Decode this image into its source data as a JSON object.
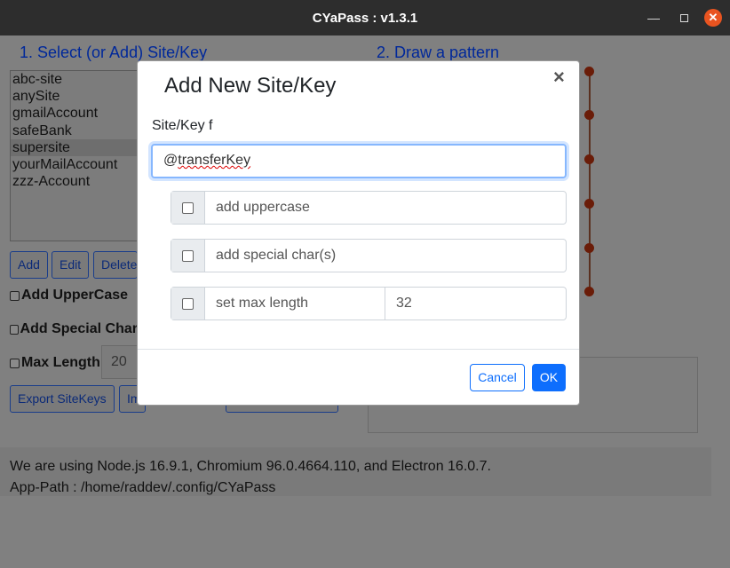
{
  "window": {
    "title": "CYaPass : v1.3.1"
  },
  "app": {
    "section1_heading": "1. Select (or Add) Site/Key",
    "section2_heading": "2. Draw a pattern",
    "site_list": [
      "abc-site",
      "anySite",
      "gmailAccount",
      "safeBank",
      "supersite",
      "yourMailAccount",
      "zzz-Account"
    ],
    "selected_site": "supersite",
    "buttons": {
      "add": "Add",
      "edit": "Edit",
      "delete": "Delete",
      "export": "Export SiteKeys",
      "import": "Im"
    },
    "options": {
      "uppercase": "Add UpperCase",
      "special": "Add Special Char",
      "maxlength": "Max Length",
      "maxlength_value": "20"
    },
    "info_line1": "We are using Node.js 16.9.1, Chromium 96.0.4664.110, and Electron 16.0.7.",
    "info_line2": "App-Path : /home/raddev/.config/CYaPass"
  },
  "modal": {
    "title": "Add New Site/Key",
    "close": "×",
    "field_label": "Site/Key f",
    "input_prefix": "@",
    "input_word": "transferKey",
    "option_uppercase": "add uppercase",
    "option_special": "add special char(s)",
    "option_maxlength": "set max length",
    "maxlength_value": "32",
    "cancel": "Cancel",
    "ok": "OK"
  },
  "colors": {
    "primary": "#0d6efd",
    "titlebar": "#2d2d2d",
    "close_btn": "#e95420"
  }
}
